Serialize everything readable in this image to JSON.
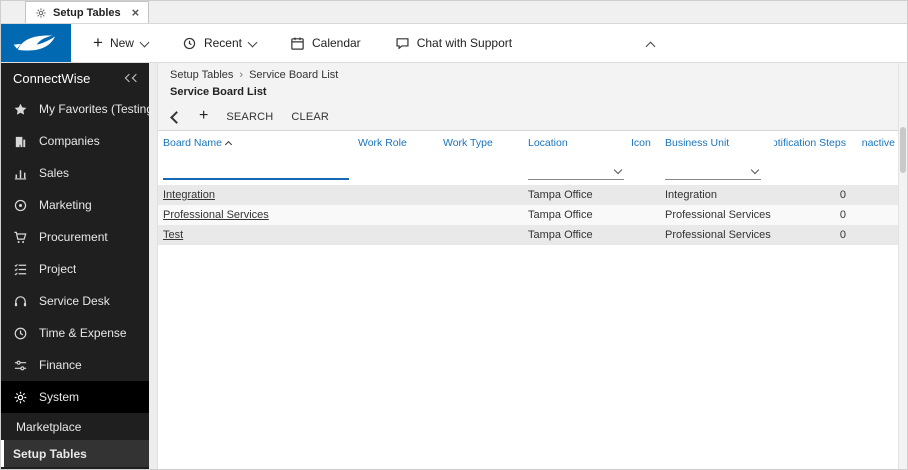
{
  "colors": {
    "accent": "#1a75bb",
    "logo-blue": "#0069b1",
    "sidebar-bg": "#1f1f1f",
    "sidebar-active-bg": "#000000",
    "row-alt": "#e9e9e9",
    "filter-focus": "#1668b5"
  },
  "tab": {
    "title": "Setup Tables"
  },
  "toolbar": {
    "new_label": "New",
    "recent_label": "Recent",
    "calendar_label": "Calendar",
    "chat_label": "Chat with Support"
  },
  "sidebar": {
    "brand": "ConnectWise",
    "items": [
      {
        "label": "My Favorites (Testing",
        "icon": "star-icon"
      },
      {
        "label": "Companies",
        "icon": "companies-icon"
      },
      {
        "label": "Sales",
        "icon": "sales-icon"
      },
      {
        "label": "Marketing",
        "icon": "marketing-icon"
      },
      {
        "label": "Procurement",
        "icon": "procurement-icon"
      },
      {
        "label": "Project",
        "icon": "project-icon"
      },
      {
        "label": "Service Desk",
        "icon": "service-desk-icon"
      },
      {
        "label": "Time & Expense",
        "icon": "time-expense-icon"
      },
      {
        "label": "Finance",
        "icon": "finance-icon"
      },
      {
        "label": "System",
        "icon": "system-icon",
        "active": true
      }
    ],
    "footer": [
      {
        "label": "Marketplace"
      },
      {
        "label": "Setup Tables",
        "active": true
      }
    ]
  },
  "main": {
    "breadcrumb": [
      "Setup Tables",
      "Service Board List"
    ],
    "page_title": "Service Board List",
    "actions": {
      "search_label": "SEARCH",
      "clear_label": "CLEAR"
    },
    "table": {
      "columns": [
        "Board Name",
        "Work Role",
        "Work Type",
        "Location",
        "Icon",
        "Business Unit",
        "Notification Steps",
        "Inactive"
      ],
      "rows": [
        {
          "board_name": "Integration",
          "work_role": "",
          "work_type": "",
          "location": "Tampa Office",
          "icon": "",
          "business_unit": "Integration",
          "notification_steps": "0",
          "inactive": ""
        },
        {
          "board_name": "Professional Services",
          "work_role": "",
          "work_type": "",
          "location": "Tampa Office",
          "icon": "",
          "business_unit": "Professional Services",
          "notification_steps": "0",
          "inactive": ""
        },
        {
          "board_name": "Test",
          "work_role": "",
          "work_type": "",
          "location": "Tampa Office",
          "icon": "",
          "business_unit": "Professional Services",
          "notification_steps": "0",
          "inactive": ""
        }
      ]
    }
  }
}
